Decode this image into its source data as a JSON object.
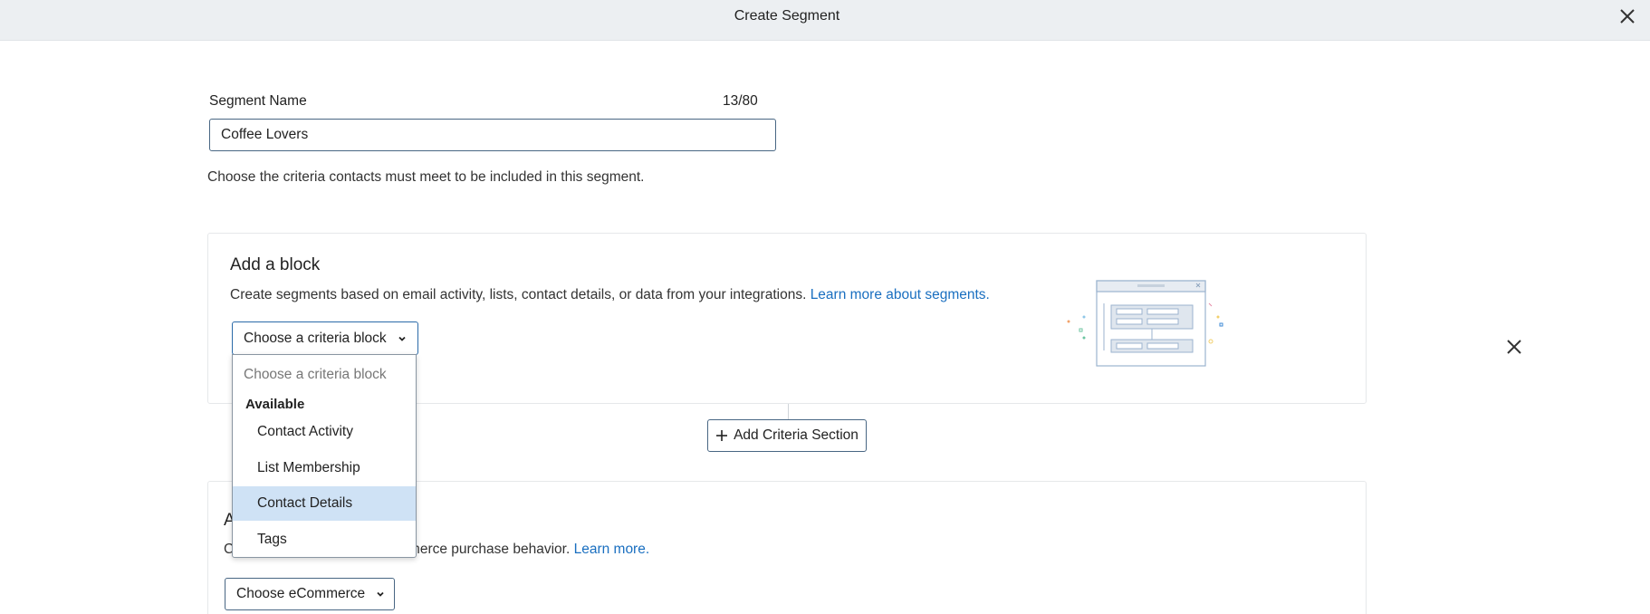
{
  "header": {
    "title": "Create Segment"
  },
  "segment_name": {
    "label": "Segment Name",
    "counter": "13/80",
    "value": "Coffee Lovers"
  },
  "instructions": "Choose the criteria contacts must meet to be included in this segment.",
  "block_card": {
    "heading": "Add a block",
    "description": "Create segments based on email activity, lists, contact details, or data from your integrations.",
    "link": "Learn more about segments.",
    "select_label": "Choose a criteria block"
  },
  "add_section_label": "Add Criteria Section",
  "ecommerce_card": {
    "heading_visible": "A",
    "description_visible_start": "C",
    "description_visible_end": "mmerce purchase behavior.",
    "link": "Learn more.",
    "select_label": "Choose eCommerce"
  },
  "dropdown": {
    "placeholder": "Choose a criteria block",
    "group_label": "Available",
    "items": [
      {
        "label": "Contact Activity"
      },
      {
        "label": "List Membership"
      },
      {
        "label": "Contact Details",
        "selected": true
      },
      {
        "label": "Tags"
      }
    ]
  },
  "colors": {
    "accent": "#1a6fc0",
    "selected_bg": "#cfe2f5",
    "border": "#486683",
    "topbar": "#eceff2"
  }
}
